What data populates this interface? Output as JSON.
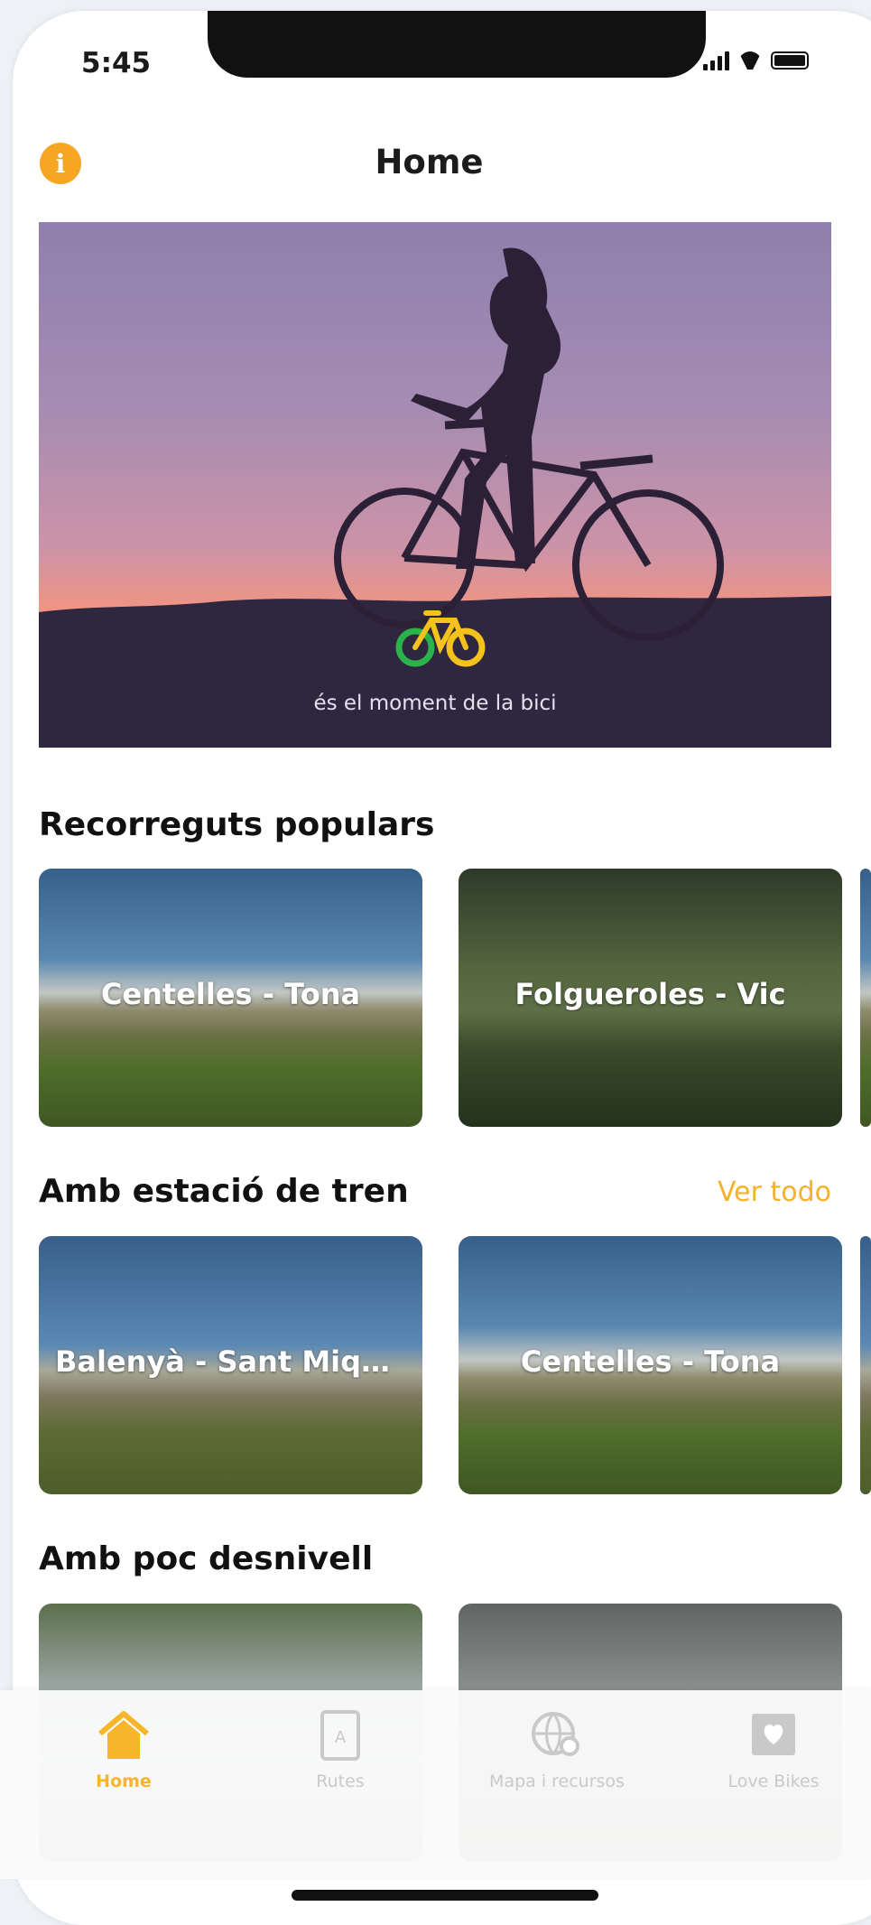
{
  "status": {
    "time": "5:45"
  },
  "header": {
    "title": "Home",
    "info_icon": "info-icon"
  },
  "hero": {
    "slogan": "és el moment de la bici",
    "logo_icon": "bicycle-logo-icon"
  },
  "sections": [
    {
      "title": "Recorreguts populars",
      "see_all": "",
      "cards": [
        {
          "label": "Centelles - Tona"
        },
        {
          "label": "Folgueroles - Vic"
        }
      ]
    },
    {
      "title": "Amb estació de tren",
      "see_all": "Ver todo",
      "cards": [
        {
          "label": "Balenyà - Sant Miqu..."
        },
        {
          "label": "Centelles - Tona"
        }
      ]
    },
    {
      "title": "Amb poc desnivell",
      "see_all": "",
      "cards": [
        {
          "label": ""
        },
        {
          "label": ""
        }
      ]
    }
  ],
  "tabbar": {
    "items": [
      {
        "label": "Home",
        "icon": "home-icon",
        "active": true
      },
      {
        "label": "Rutes",
        "icon": "map-book-icon",
        "active": false
      },
      {
        "label": "Mapa i recursos",
        "icon": "globe-pin-icon",
        "active": false
      },
      {
        "label": "Love Bikes",
        "icon": "heart-photo-icon",
        "active": false
      }
    ]
  },
  "colors": {
    "accent": "#f6a623",
    "active_tab": "#f7b52a",
    "see_all": "#f6b128"
  }
}
